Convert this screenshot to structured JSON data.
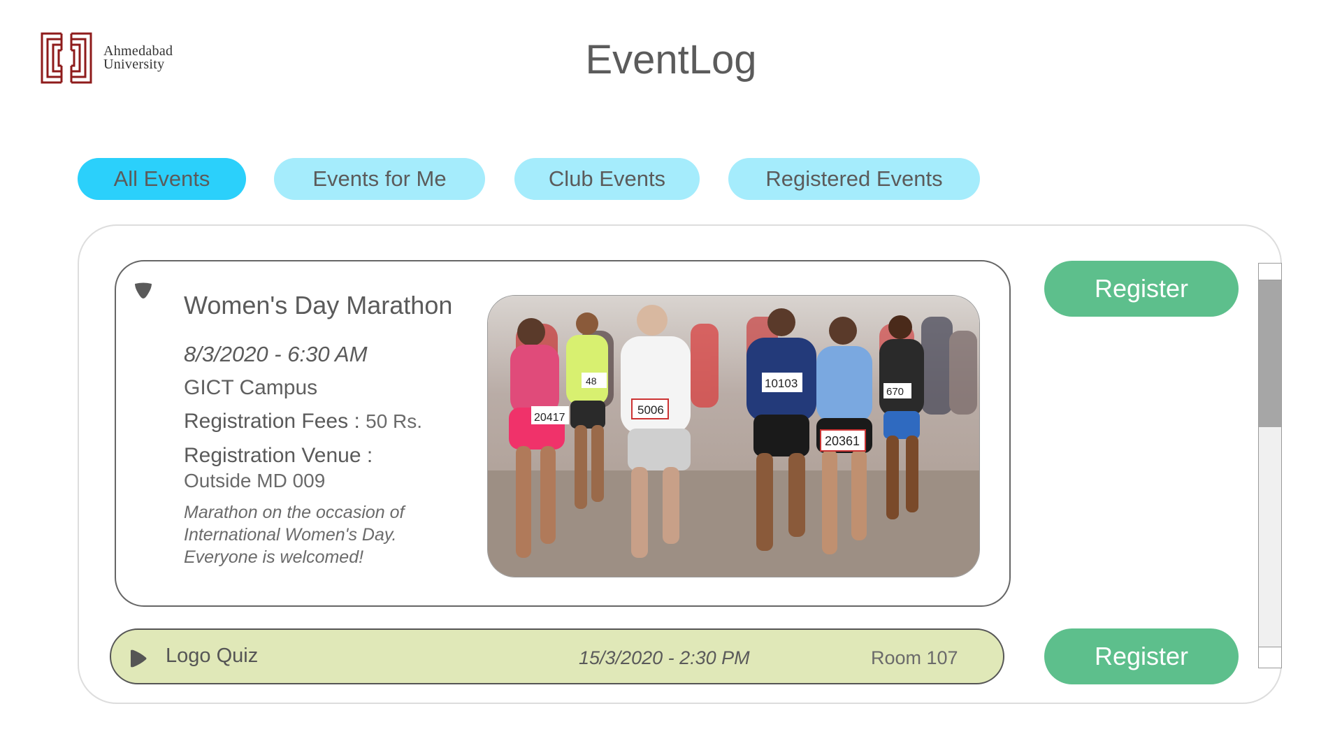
{
  "header": {
    "logo_line1": "Ahmedabad",
    "logo_line2": "University",
    "app_title": "EventLog"
  },
  "tabs": [
    {
      "label": "All Events",
      "active": true
    },
    {
      "label": "Events for Me",
      "active": false
    },
    {
      "label": "Club Events",
      "active": false
    },
    {
      "label": "Registered Events",
      "active": false
    }
  ],
  "events": [
    {
      "title": "Women's Day Marathon",
      "date": "8/3/2020 - 6:30 AM",
      "place": "GICT Campus",
      "fees_label": "Registration Fees :",
      "fees_value": "50 Rs.",
      "venue_label": "Registration Venue :",
      "venue_value": "Outside MD 009",
      "description": "Marathon on the occasion of International Women's Day. Everyone is welcomed!",
      "expanded": true,
      "register_label": "Register",
      "bib_numbers": [
        "20417",
        "5006",
        "10103",
        "20361",
        "670",
        "48"
      ]
    },
    {
      "title": "Logo Quiz",
      "date": "15/3/2020 - 2:30 PM",
      "place": "Room 107",
      "expanded": false,
      "register_label": "Register"
    }
  ],
  "colors": {
    "tab_active": "#2bd0fb",
    "tab_inactive": "#a5ecfc",
    "register": "#5dbf8c",
    "collapsed_row": "#e0e8b8",
    "logo_red": "#8e1b1b"
  },
  "icons": {
    "expanded_toggle": "chevron-down-icon",
    "collapsed_toggle": "chevron-right-icon",
    "logo": "university-logo-icon"
  }
}
